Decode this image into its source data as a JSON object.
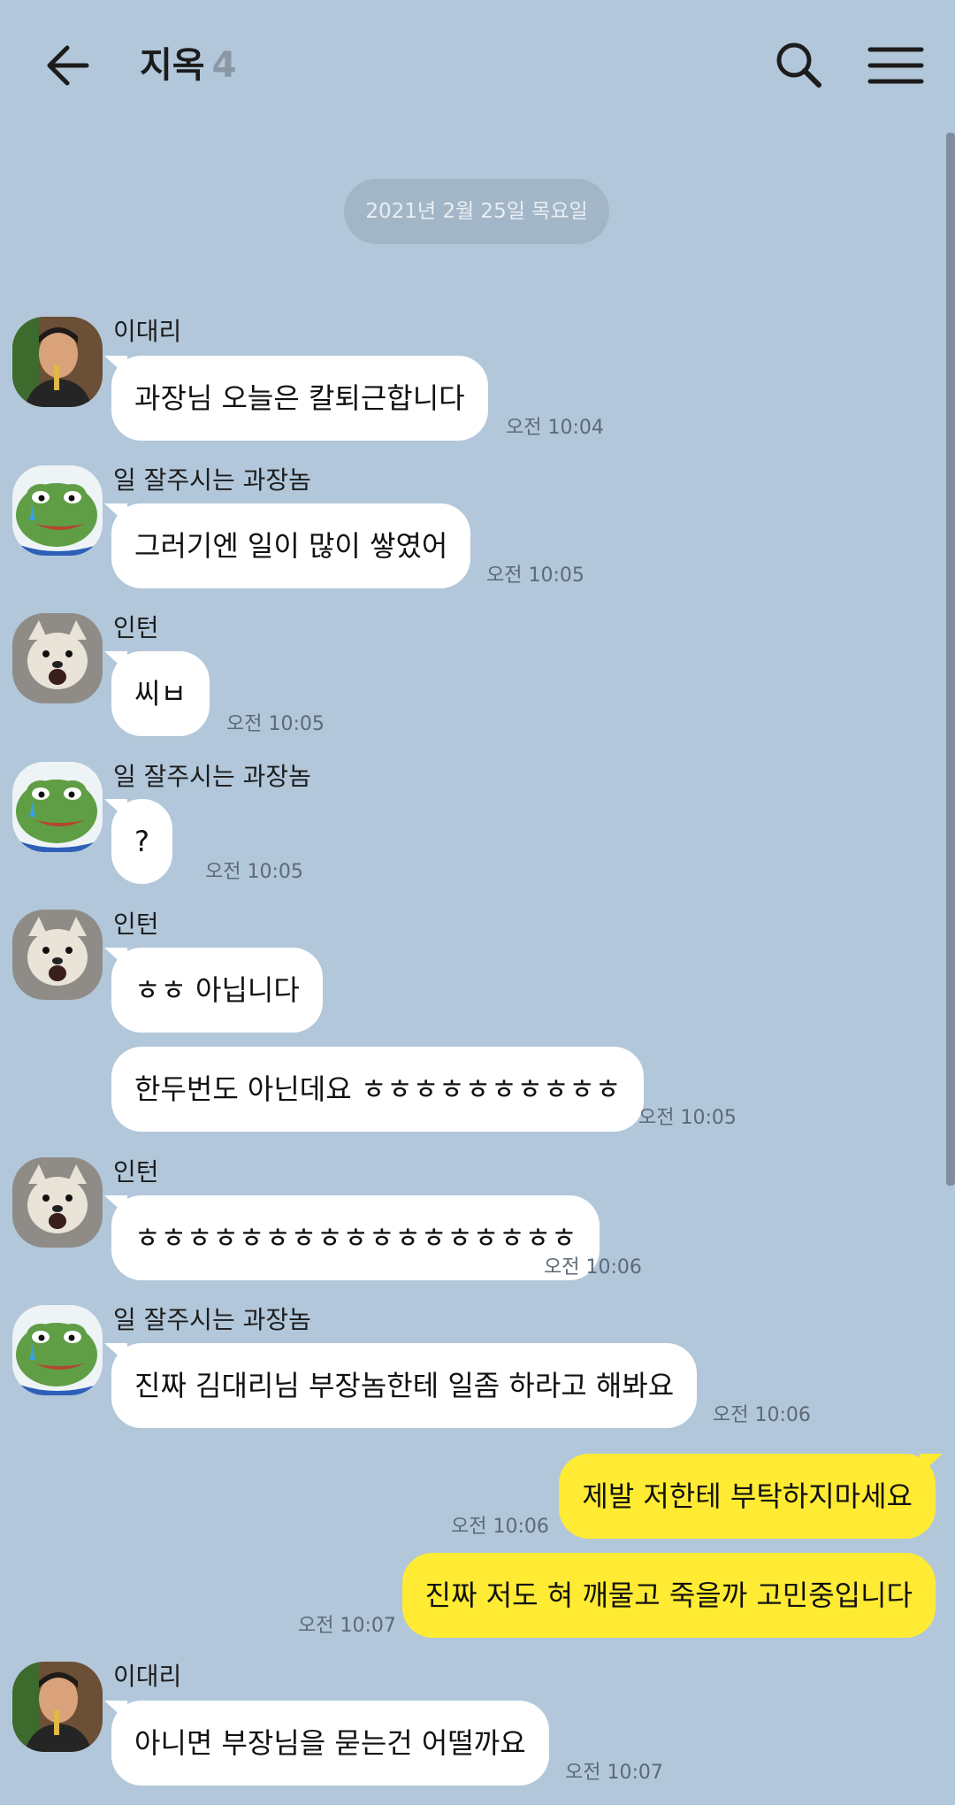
{
  "header": {
    "title": "지옥",
    "member_count": "4"
  },
  "date_divider": "2021년 2월 25일 목요일",
  "messages": [
    {
      "sender": "이대리",
      "text": "과장님 오늘은 칼퇴근합니다",
      "time": "오전 10:04"
    },
    {
      "sender": "일 잘주시는 과장놈",
      "text": "그러기엔 일이 많이 쌓였어",
      "time": "오전 10:05"
    },
    {
      "sender": "인턴",
      "text": "씨ㅂ",
      "time": "오전 10:05"
    },
    {
      "sender": "일 잘주시는 과장놈",
      "text": "?",
      "time": "오전 10:05"
    },
    {
      "sender": "인턴",
      "text": "ㅎㅎ 아닙니다"
    },
    {
      "text": "한두번도 아닌데요 ㅎㅎㅎㅎㅎㅎㅎㅎㅎㅎ",
      "time": "오전 10:05"
    },
    {
      "sender": "인턴",
      "text": "ㅎㅎㅎㅎㅎㅎㅎㅎㅎㅎㅎㅎㅎㅎㅎㅎㅎ",
      "time": "오전 10:06"
    },
    {
      "sender": "일 잘주시는 과장놈",
      "text": "진짜 김대리님 부장놈한테 일좀 하라고 해봐요",
      "time": "오전 10:06"
    },
    {
      "sender": "me",
      "text": "제발 저한테 부탁하지마세요",
      "time": "오전 10:06"
    },
    {
      "sender": "me",
      "text": "진짜 저도 혀 깨물고 죽을까 고민중입니다",
      "time": "오전 10:07"
    },
    {
      "sender": "이대리",
      "text": "아니면 부장님을 묻는건 어떨까요",
      "time": "오전 10:07"
    }
  ],
  "icons": {
    "back": "arrow-left-icon",
    "search": "search-icon",
    "menu": "hamburger-menu-icon"
  },
  "colors": {
    "background": "#b2c7da",
    "incoming_bubble": "#ffffff",
    "outgoing_bubble": "#ffeb33",
    "timestamp": "#5e6a76",
    "date_pill": "#a3b6c8"
  }
}
